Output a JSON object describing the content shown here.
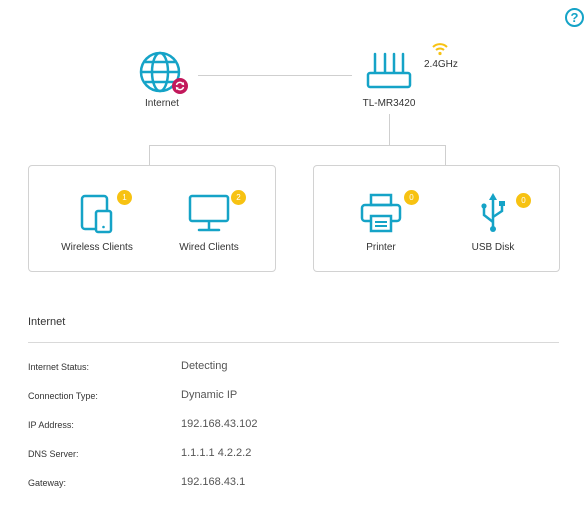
{
  "help_label": "?",
  "colors": {
    "accent": "#15a3c7",
    "badge": "#f7c212",
    "internet_status_badge": "#c2185b",
    "wifi_icon": "#f7c212"
  },
  "topology": {
    "internet": {
      "label": "Internet",
      "icon": "globe-icon",
      "status_icon": "refresh-icon"
    },
    "router": {
      "label": "TL-MR3420",
      "icon": "router-icon"
    },
    "wifi_band": "2.4GHz"
  },
  "clients": [
    {
      "label": "Wireless Clients",
      "count": "1",
      "icon": "tablet-phone-icon"
    },
    {
      "label": "Wired Clients",
      "count": "2",
      "icon": "monitor-icon"
    }
  ],
  "devices": [
    {
      "label": "Printer",
      "count": "0",
      "icon": "printer-icon"
    },
    {
      "label": "USB Disk",
      "count": "0",
      "icon": "usb-icon"
    }
  ],
  "internet_section": {
    "title": "Internet",
    "rows": [
      {
        "label": "Internet Status:",
        "value": "Detecting"
      },
      {
        "label": "Connection Type:",
        "value": "Dynamic IP"
      },
      {
        "label": "IP Address:",
        "value": "192.168.43.102"
      },
      {
        "label": "DNS Server:",
        "value": "1.1.1.1 4.2.2.2"
      },
      {
        "label": "Gateway:",
        "value": "192.168.43.1"
      }
    ]
  }
}
